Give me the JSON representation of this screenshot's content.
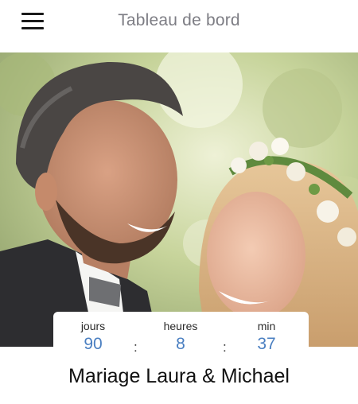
{
  "header": {
    "title": "Tableau de bord",
    "menu_icon": "hamburger-menu-icon"
  },
  "hero": {
    "alt": "Wedding couple photo"
  },
  "countdown": {
    "days_label": "jours",
    "days_value": "90",
    "hours_label": "heures",
    "hours_value": "8",
    "minutes_label": "min",
    "minutes_value": "37",
    "separator": ":"
  },
  "event": {
    "title": "Mariage Laura & Michael"
  },
  "colors": {
    "accent": "#4a7fc1",
    "title_gray": "#7d7d84"
  }
}
